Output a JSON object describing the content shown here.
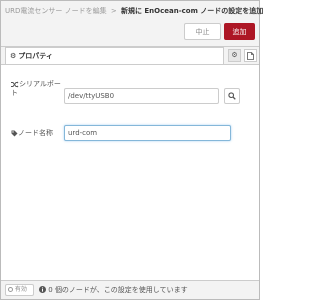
{
  "header": {
    "breadcrumb_1": "URD電流センサー ノードを編集",
    "separator": ">",
    "breadcrumb_2": "新規に EnOcean-com ノードの設定を追加",
    "cancel_label": "中止",
    "add_label": "追加"
  },
  "tabs": {
    "properties_label": "プロパティ"
  },
  "form": {
    "serial_port_label": "シリアルポート",
    "serial_port_value": "/dev/ttyUSB0",
    "name_label": "ノード名称",
    "name_value": "urd-com"
  },
  "footer": {
    "toggle_label": "有効",
    "usage_count": "0",
    "usage_text": "個のノードが、この設定を使用しています"
  },
  "colors": {
    "accent": "#ad1625",
    "focus_border": "#85b7d9"
  }
}
